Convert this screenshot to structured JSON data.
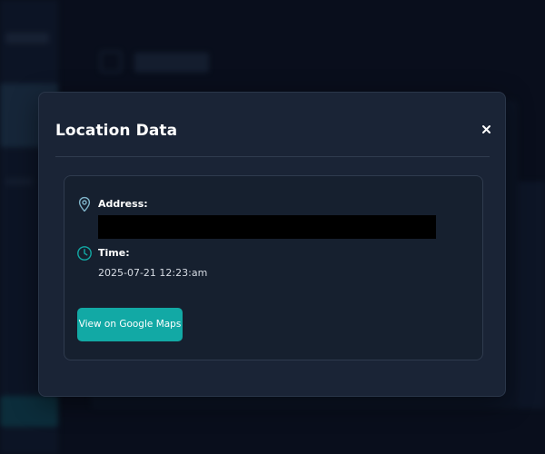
{
  "modal": {
    "title": "Location Data",
    "close_label": "x",
    "address": {
      "icon": "map-pin-icon",
      "label": "Address:",
      "value": "",
      "redacted": true
    },
    "time": {
      "icon": "clock-icon",
      "label": "Time:",
      "value": "2025-07-21 12:23:am"
    },
    "maps_button_label": "View on Google Maps"
  },
  "colors": {
    "accent": "#12a9a5",
    "modal_bg": "#1a2436",
    "card_bg": "#16202f",
    "text": "#ffffff",
    "muted_text": "#d7dce4",
    "border": "#2f3b4e"
  }
}
